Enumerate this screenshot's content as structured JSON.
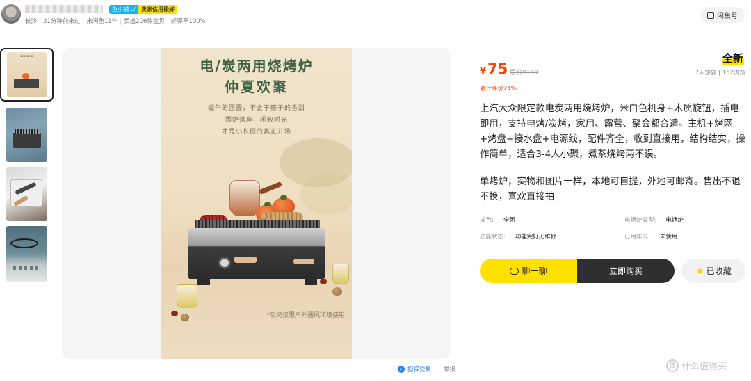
{
  "seller": {
    "level_badge": "鱼小铺 L4",
    "credit_badge": "卖家信用极好",
    "meta": [
      "长沙",
      "31分钟前来过",
      "来闲鱼11年",
      "卖出206件宝贝",
      "好评率100%"
    ]
  },
  "header": {
    "store_button_label": "闲鱼号"
  },
  "poster": {
    "title_line1": "电/炭两用烧烤炉",
    "title_line2": "仲夏欢聚",
    "body_lines": [
      "端午的团圆，不止于粽子的香甜",
      "围炉落座，闲叙时光",
      "才是小长假的真正开场"
    ],
    "note": "*炭烤仅限户外通风环境使用"
  },
  "footer_links": {
    "protection": "担保交易",
    "report": "举报"
  },
  "product": {
    "condition": "全新",
    "currency": "¥",
    "price": "75",
    "original_price": "原价¥180",
    "stats": "7人想要 | 152浏览",
    "discount": "累计降价24%",
    "description_p1": "上汽大众限定款电炭两用烧烤炉，米白色机身+木质旋钮，插电即用，支持电烤/炭烤，家用、露营、聚会都合适。主机+烤网+烤盘+接水盘+电源线，配件齐全，收到直接用，结构结实，操作简单，适合3-4人小聚，煮茶烧烤两不误。",
    "description_p2": "单烤炉，实物和图片一样，本地可自提，外地可邮寄。售出不退不换，喜欢直接拍",
    "specs": [
      {
        "key": "成色:",
        "value": "全新"
      },
      {
        "key": "电烤炉类型:",
        "value": "电烤炉"
      },
      {
        "key": "功能状态:",
        "value": "功能完好无维修"
      },
      {
        "key": "已用年限:",
        "value": "未使用"
      }
    ]
  },
  "actions": {
    "chat_label": "聊一聊",
    "buy_label": "立即购买",
    "favorite_label": "已收藏"
  },
  "watermark": {
    "icon_text": "值",
    "text": "什么值得买"
  },
  "colors": {
    "price": "#ff4000",
    "accent_yellow": "#ffe100",
    "buy_button": "#2f2f2f",
    "poster_title": "#3d6242"
  }
}
